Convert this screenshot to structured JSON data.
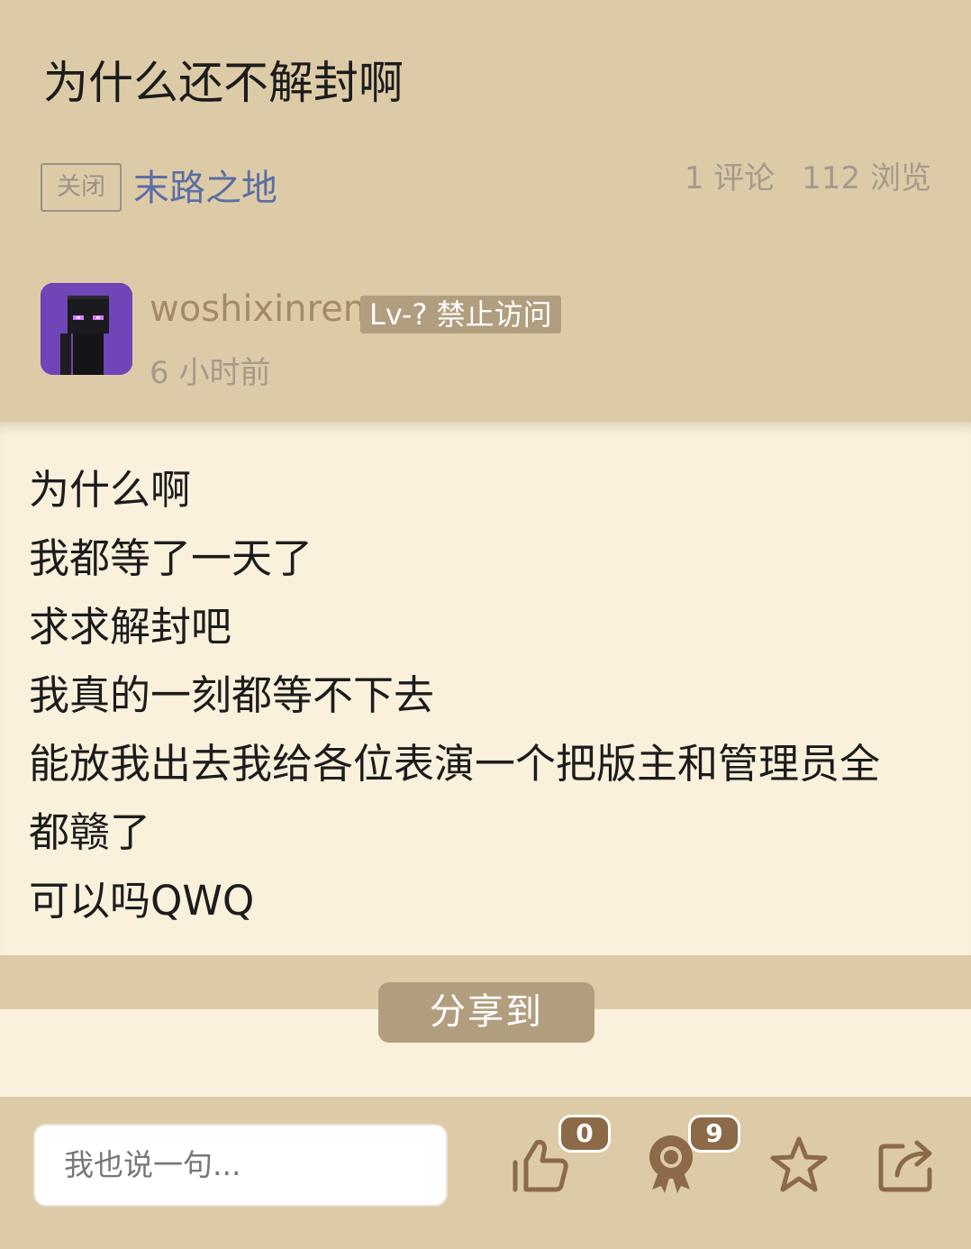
{
  "post": {
    "title": "为什么还不解封啊",
    "status_tag": "关闭",
    "board": "末路之地",
    "comments": "1 评论",
    "views": "112 浏览"
  },
  "author": {
    "username": "woshixinren",
    "level_badge": "Lv-? 禁止访问",
    "time": "6 小时前",
    "avatar_icon": "enderman-avatar"
  },
  "content": {
    "lines": [
      "为什么啊",
      "我都等了一天了",
      "求求解封吧",
      "我真的一刻都等不下去",
      "能放我出去我给各位表演一个把版主和管理员全",
      "都赣了",
      "可以吗QWQ"
    ]
  },
  "share": {
    "label": "分享到"
  },
  "bottom_bar": {
    "comment_placeholder": "我也说一句...",
    "like_count": "0",
    "award_count": "9",
    "icons": [
      "thumbs-up-icon",
      "award-icon",
      "star-icon",
      "share-icon"
    ]
  },
  "colors": {
    "header_bg": "#ddcba8",
    "content_bg": "#faf1dd",
    "accent": "#b09e7f",
    "link": "#5a6fa3",
    "icon": "#8c6a48"
  }
}
